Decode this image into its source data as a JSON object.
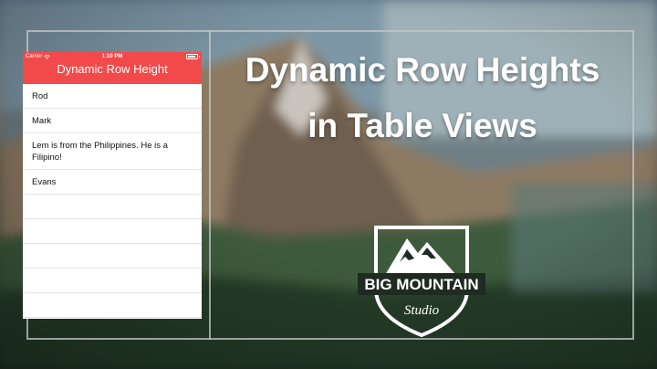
{
  "phone": {
    "status": {
      "carrier": "Carrier",
      "time": "1:10 PM"
    },
    "nav_title": "Dynamic Row Height",
    "rows": [
      "Rod",
      "Mark",
      "Lem is from the Philippines. He is a Filipino!",
      "Evans"
    ]
  },
  "headline": "Dynamic Row Heights in Table Views",
  "logo": {
    "line1": "BIG MOUNTAIN",
    "line2": "Studio"
  },
  "colors": {
    "navbar": "#f24a4a",
    "frame": "#c8c8c8",
    "text_light": "#ffffff"
  }
}
